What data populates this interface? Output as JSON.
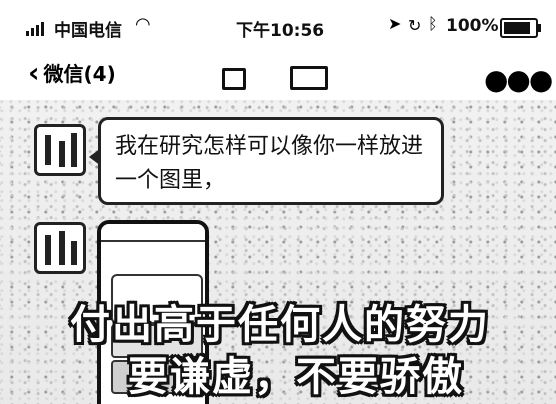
{
  "status_bar": {
    "carrier": "中国电信",
    "time": "下午10:56",
    "battery_percent": "100%",
    "battery_level": 1.0
  },
  "nav": {
    "back_label": "微信(4)"
  },
  "message": {
    "text": "我在研究怎样可以像你一样放进一个图里，"
  },
  "overlay_text": {
    "line1": "付出高于任何人的努力",
    "line2": "要谦虚，不要骄傲"
  },
  "icons": {
    "signal": "signal-icon",
    "wifi": "wifi-icon",
    "location": "location-icon",
    "lock": "rotation-lock-icon",
    "bluetooth": "bluetooth-icon",
    "battery": "battery-icon",
    "back": "chevron-left-icon",
    "more": "more-icon"
  }
}
